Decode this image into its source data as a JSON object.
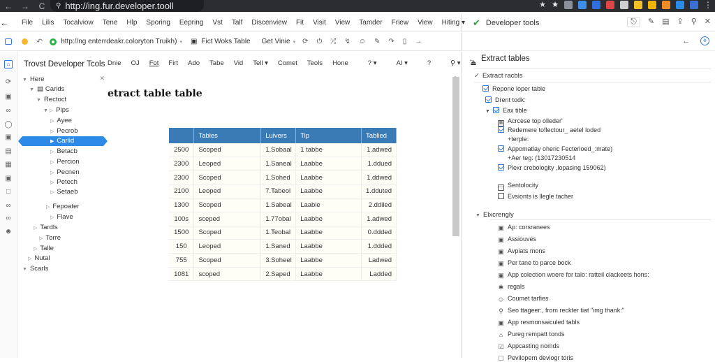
{
  "browser": {
    "url": "http://ing.fur.developer.tooll",
    "back": "←",
    "forward": "→",
    "reload": "C",
    "bookmark_icons": [
      "★",
      "★"
    ],
    "extension_colors": [
      "#8a8f99",
      "#3c8ee8",
      "#2f6fe0",
      "#e04545",
      "#cfcfcf",
      "#f3c224",
      "#f0b400",
      "#f08a24",
      "#2a8ae8",
      "#3b6fd8"
    ]
  },
  "menubar": {
    "items": [
      "File",
      "Lilis",
      "Tocalviow",
      "Tene",
      "Hlp",
      "Sporing",
      "Eepring",
      "Vst",
      "Talf",
      "Discenview",
      "Fit",
      "Visit",
      "View",
      "Tamder",
      "Friew",
      "View",
      "Hiting ▾"
    ]
  },
  "addressbar": {
    "url": "http://ng enterrdeakr.coloryton Truikh)",
    "tab1": "Fict Woks Table",
    "tab2": "Get Vinie",
    "tool_icons": [
      "⟳",
      "⏻",
      "⤮",
      "↯",
      "☺",
      "✎",
      "↷",
      "▯",
      "→"
    ]
  },
  "devtools": {
    "title": "Developer tools",
    "icons": [
      "🔒",
      "✎",
      "▤",
      "⇪",
      "🔍",
      "✕"
    ],
    "panel_title": "Extract tables",
    "section1": {
      "title": "Extract racbls",
      "items": [
        {
          "label": "Repone loper table",
          "checked": true
        },
        {
          "label": "Drent todk:",
          "checked": true
        },
        {
          "label": "Eax tible",
          "checked": true
        }
      ],
      "subitems": [
        {
          "label": "Acrcese top olleder'",
          "icon": "grid"
        },
        {
          "label": "Redemere toflectour_ aetel loded",
          "sub": "+terple:",
          "checked": true
        },
        {
          "label": "Appomatlay oheric Fecterioed_:mate)",
          "sub": "+Aer teg: (13017230514",
          "checked": true
        },
        {
          "label": "Plexr crebologity ,lopasing 159062)",
          "checked": true
        }
      ],
      "extra": [
        {
          "label": "Sentolocity",
          "icon": "calendar"
        },
        {
          "label": "Evsionts is llegle tacher",
          "icon": "box"
        }
      ]
    },
    "section2": {
      "title": "Elxcrengly",
      "items": [
        {
          "label": "Ap: corsranees",
          "icon": "▣"
        },
        {
          "label": "Assiouves",
          "icon": "▣"
        },
        {
          "label": "Avpiats mons",
          "icon": "▣"
        },
        {
          "label": "Per tane to parce bock",
          "icon": "▣"
        },
        {
          "label": "App colection woere for talo: ratteil clackeets hons:",
          "icon": "▣"
        },
        {
          "label": "regals",
          "icon": "✱"
        },
        {
          "label": "Coumet tarfies",
          "icon": "◇"
        },
        {
          "label": "Seo ttageer:, from reckter tiat \"img thank:\"",
          "icon": "⚲"
        },
        {
          "label": "App resmonsaiculed tabls",
          "icon": "▣"
        },
        {
          "label": "Pureg rempatt tonds",
          "icon": "⌂"
        },
        {
          "label": "Appcasting nomds",
          "icon": "☑"
        },
        {
          "label": "Pevilopern deviogr toris",
          "icon": "☐"
        }
      ]
    }
  },
  "tree": {
    "title": "Trovst Developer Tcols",
    "nodes": [
      {
        "label": "Here",
        "tw": "▼"
      },
      {
        "label": "Carids",
        "tw": "▼"
      },
      {
        "label": "Rectoct",
        "tw": "▼"
      },
      {
        "label": "Pips",
        "tw": "▼ ▷"
      },
      {
        "label": "Ayee",
        "tw": "▷"
      },
      {
        "label": "Pecrob",
        "tw": "▷"
      },
      {
        "label": "Carlid",
        "tw": "▶",
        "selected": true
      },
      {
        "label": "Betacb",
        "tw": "▷"
      },
      {
        "label": "Percion",
        "tw": "▷"
      },
      {
        "label": "Pecnen",
        "tw": "▷"
      },
      {
        "label": "Petech",
        "tw": "▷"
      },
      {
        "label": "Setaeb",
        "tw": "▷"
      },
      {
        "label": "Fepoater",
        "tw": "▷"
      },
      {
        "label": "Flave",
        "tw": "▷"
      },
      {
        "label": "Tardls",
        "tw": "▷"
      },
      {
        "label": "Torre",
        "tw": "▷"
      },
      {
        "label": "Talle",
        "tw": "▷"
      },
      {
        "label": "Nutal",
        "tw": "▷"
      },
      {
        "label": "Scarls",
        "tw": "▼"
      }
    ]
  },
  "toolbar": {
    "items": [
      "Dnie",
      "OJ",
      "Fot",
      "Firt",
      "Ado",
      "Tabe",
      "Vid",
      "Tell ▾",
      "Comet",
      "Teols",
      "Hone",
      "? ▾",
      "AI ▾",
      "?",
      "⚲ ▾",
      "⏏"
    ]
  },
  "page": {
    "title": "etract table table"
  },
  "table": {
    "headers": [
      "",
      "Tables",
      "Luivers",
      "Tip",
      "Tablied"
    ],
    "rows": [
      [
        "2500",
        "Scoped",
        "1.Sobaal",
        "1 tabbe",
        "1.adwed"
      ],
      [
        "2300",
        "Leoped",
        "1.Saneal",
        "Laabbe",
        "1.ddued"
      ],
      [
        "2300",
        "Scoped",
        "1.Sohed",
        "Laabbe",
        "1.ddwed"
      ],
      [
        "2100",
        "Leoped",
        "7.Tabeol",
        "Laabbe",
        "1.dduted"
      ],
      [
        "1300",
        "Scoped",
        "1.Sabeal",
        "Laabie",
        "2.ddiled"
      ],
      [
        "100s",
        "sceped",
        "1.77obal",
        "Laabbe",
        "1.adwed"
      ],
      [
        "1500",
        "Scoped",
        "1.Teobal",
        "Laabbe",
        "0.ddded"
      ],
      [
        "150",
        "Leoped",
        "1.Saned",
        "Laabbe",
        "1.ddded"
      ],
      [
        "755",
        "Scoped",
        "3.Soheel",
        "Laabbe",
        "Ladwed"
      ],
      [
        "1081",
        "scoped",
        "2.Saped",
        "Laabbe",
        "Ladded"
      ]
    ]
  }
}
